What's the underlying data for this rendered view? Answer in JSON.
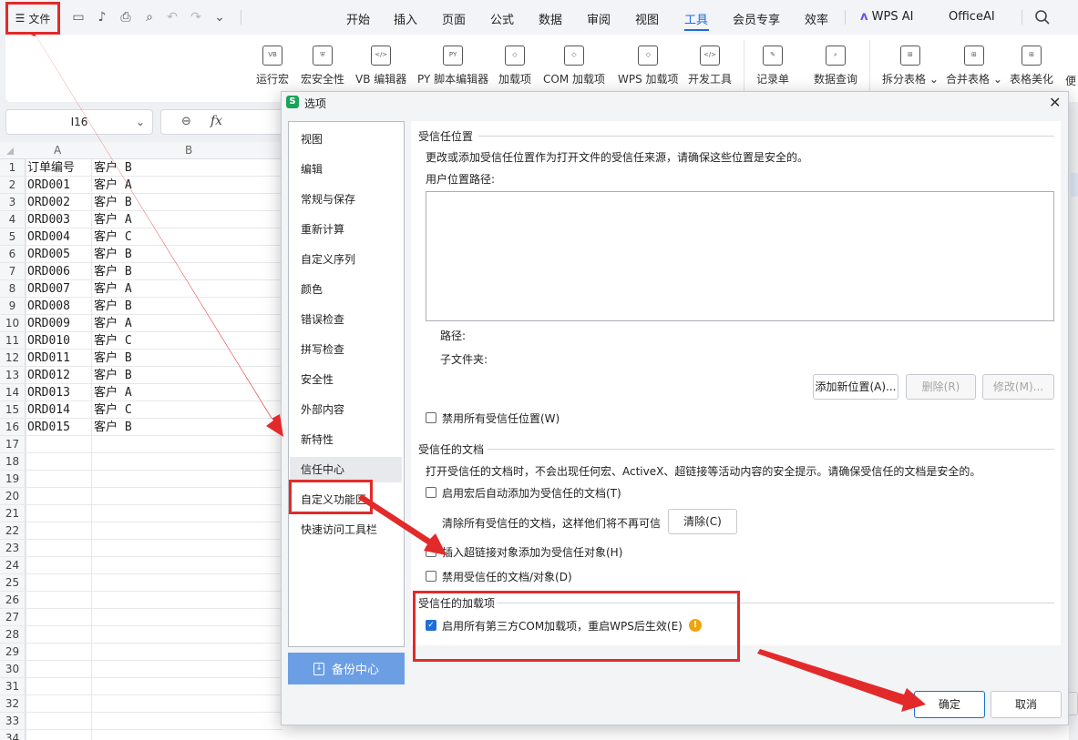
{
  "menubar": {
    "file_label": "文件",
    "tabs": [
      "开始",
      "插入",
      "页面",
      "公式",
      "数据",
      "审阅",
      "视图",
      "工具",
      "会员专享",
      "效率",
      "WPS AI",
      "OfficeAI"
    ],
    "active_tab": "工具"
  },
  "ribbon": {
    "buttons": [
      "运行宏",
      "宏安全性",
      "VB 编辑器",
      "PY 脚本编辑器",
      "加载项",
      "COM 加载项",
      "WPS 加载项",
      "开发工具",
      "记录单",
      "数据查询",
      "拆分表格",
      "合并表格",
      "表格美化",
      "便"
    ]
  },
  "formula_bar": {
    "cell_ref": "I16"
  },
  "sheet": {
    "columns": [
      "A",
      "B"
    ],
    "rows": [
      {
        "n": "1",
        "a": "订单编号",
        "b": "客户 B"
      },
      {
        "n": "2",
        "a": "ORD001",
        "b": "客户 A"
      },
      {
        "n": "3",
        "a": "ORD002",
        "b": "客户 B"
      },
      {
        "n": "4",
        "a": "ORD003",
        "b": "客户 A"
      },
      {
        "n": "5",
        "a": "ORD004",
        "b": "客户 C"
      },
      {
        "n": "6",
        "a": "ORD005",
        "b": "客户 B"
      },
      {
        "n": "7",
        "a": "ORD006",
        "b": "客户 B"
      },
      {
        "n": "8",
        "a": "ORD007",
        "b": "客户 A"
      },
      {
        "n": "9",
        "a": "ORD008",
        "b": "客户 B"
      },
      {
        "n": "10",
        "a": "ORD009",
        "b": "客户 A"
      },
      {
        "n": "11",
        "a": "ORD010",
        "b": "客户 C"
      },
      {
        "n": "12",
        "a": "ORD011",
        "b": "客户 B"
      },
      {
        "n": "13",
        "a": "ORD012",
        "b": "客户 B"
      },
      {
        "n": "14",
        "a": "ORD013",
        "b": "客户 A"
      },
      {
        "n": "15",
        "a": "ORD014",
        "b": "客户 C"
      },
      {
        "n": "16",
        "a": "ORD015",
        "b": "客户 B"
      }
    ],
    "empty_rows": [
      "17",
      "18",
      "19",
      "20",
      "21",
      "22",
      "23",
      "24",
      "25",
      "26",
      "27",
      "28",
      "29",
      "30",
      "31",
      "32",
      "33",
      "34"
    ]
  },
  "dialog": {
    "title": "选项",
    "nav": [
      "视图",
      "编辑",
      "常规与保存",
      "重新计算",
      "自定义序列",
      "颜色",
      "错误检查",
      "拼写检查",
      "安全性",
      "外部内容",
      "新特性",
      "信任中心",
      "自定义功能区",
      "快速访问工具栏"
    ],
    "selected_nav": "信任中心",
    "backup_label": "备份中心",
    "trusted_locations": {
      "title": "受信任位置",
      "desc": "更改或添加受信任位置作为打开文件的受信任来源，请确保这些位置是安全的。",
      "user_path_label": "用户位置路径:",
      "path_label": "路径:",
      "subfolder_label": "子文件夹:",
      "add_btn": "添加新位置(A)...",
      "delete_btn": "删除(R)",
      "modify_btn": "修改(M)...",
      "disable_all": "禁用所有受信任位置(W)"
    },
    "trusted_docs": {
      "title": "受信任的文档",
      "desc": "打开受信任的文档时，不会出现任何宏、ActiveX、超链接等活动内容的安全提示。请确保受信任的文档是安全的。",
      "auto_add": "启用宏后自动添加为受信任的文档(T)",
      "clear_text": "清除所有受信任的文档，这样他们将不再可信",
      "clear_btn": "清除(C)",
      "insert_hyperlink": "插入超链接对象添加为受信任对象(H)",
      "disable_trusted": "禁用受信任的文档/对象(D)"
    },
    "trusted_addins": {
      "title": "受信任的加载项",
      "enable_com": "启用所有第三方COM加载项，重启WPS后生效(E)",
      "enable_com_checked": true
    },
    "ok_btn": "确定",
    "cancel_btn": "取消"
  },
  "colors": {
    "accent": "#1e6be0",
    "highlight_red": "#e32a2a",
    "backup_blue": "#6c9ee3",
    "warning": "#f0a30a"
  },
  "icons": [
    "hamburger-icon",
    "save-icon",
    "brush-icon",
    "print-icon",
    "print-preview-icon",
    "undo-icon",
    "redo-icon",
    "more-icon",
    "search-icon",
    "wps-ai-icon",
    "zoom-icon",
    "fx-icon",
    "close-icon",
    "warning-icon",
    "checkbox-checked-icon"
  ]
}
